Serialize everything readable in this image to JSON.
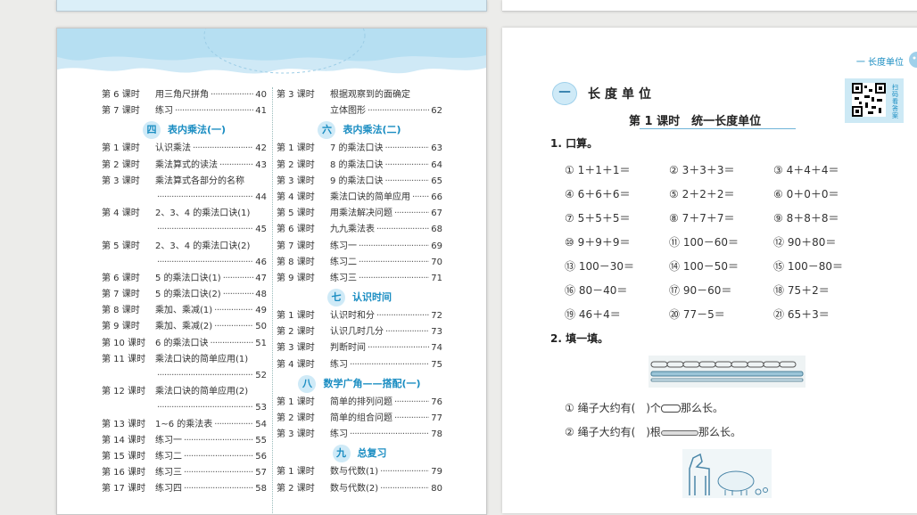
{
  "toc": {
    "left": [
      {
        "type": "row",
        "lesson": "第 6 课时",
        "title": "用三角尺拼角",
        "page": "40"
      },
      {
        "type": "row",
        "lesson": "第 7 课时",
        "title": "练习",
        "page": "41"
      },
      {
        "type": "unit",
        "num": "四",
        "title": "表内乘法(一)"
      },
      {
        "type": "row",
        "lesson": "第 1 课时",
        "title": "认识乘法",
        "page": "42"
      },
      {
        "type": "row",
        "lesson": "第 2 课时",
        "title": "乘法算式的读法",
        "page": "43"
      },
      {
        "type": "row",
        "lesson": "第 3 课时",
        "title": "乘法算式各部分的名称",
        "page": ""
      },
      {
        "type": "cont",
        "page": "44"
      },
      {
        "type": "row",
        "lesson": "第 4 课时",
        "title": "2、3、4 的乘法口诀(1)",
        "page": ""
      },
      {
        "type": "cont",
        "page": "45"
      },
      {
        "type": "row",
        "lesson": "第 5 课时",
        "title": "2、3、4 的乘法口诀(2)",
        "page": ""
      },
      {
        "type": "cont",
        "page": "46"
      },
      {
        "type": "row",
        "lesson": "第 6 课时",
        "title": "5 的乘法口诀(1)",
        "page": "47"
      },
      {
        "type": "row",
        "lesson": "第 7 课时",
        "title": "5 的乘法口诀(2)",
        "page": "48"
      },
      {
        "type": "row",
        "lesson": "第 8 课时",
        "title": "乘加、乘减(1)",
        "page": "49"
      },
      {
        "type": "row",
        "lesson": "第 9 课时",
        "title": "乘加、乘减(2)",
        "page": "50"
      },
      {
        "type": "row",
        "lesson": "第 10 课时",
        "title": "6 的乘法口诀",
        "page": "51"
      },
      {
        "type": "row",
        "lesson": "第 11 课时",
        "title": "乘法口诀的简单应用(1)",
        "page": ""
      },
      {
        "type": "cont",
        "page": "52"
      },
      {
        "type": "row",
        "lesson": "第 12 课时",
        "title": "乘法口诀的简单应用(2)",
        "page": ""
      },
      {
        "type": "cont",
        "page": "53"
      },
      {
        "type": "row",
        "lesson": "第 13 课时",
        "title": "1~6 的乘法表",
        "page": "54"
      },
      {
        "type": "row",
        "lesson": "第 14 课时",
        "title": "练习一",
        "page": "55"
      },
      {
        "type": "row",
        "lesson": "第 15 课时",
        "title": "练习二",
        "page": "56"
      },
      {
        "type": "row",
        "lesson": "第 16 课时",
        "title": "练习三",
        "page": "57"
      },
      {
        "type": "row",
        "lesson": "第 17 课时",
        "title": "练习四",
        "page": "58"
      }
    ],
    "right": [
      {
        "type": "row",
        "lesson": "第 3 课时",
        "title": "根据观察到的面确定",
        "page": ""
      },
      {
        "type": "cont",
        "text": "立体图形",
        "page": "62"
      },
      {
        "type": "unit",
        "num": "六",
        "title": "表内乘法(二)"
      },
      {
        "type": "row",
        "lesson": "第 1 课时",
        "title": "7 的乘法口诀",
        "page": "63"
      },
      {
        "type": "row",
        "lesson": "第 2 课时",
        "title": "8 的乘法口诀",
        "page": "64"
      },
      {
        "type": "row",
        "lesson": "第 3 课时",
        "title": "9 的乘法口诀",
        "page": "65"
      },
      {
        "type": "row",
        "lesson": "第 4 课时",
        "title": "乘法口诀的简单应用",
        "page": "66"
      },
      {
        "type": "row",
        "lesson": "第 5 课时",
        "title": "用乘法解决问题",
        "page": "67"
      },
      {
        "type": "row",
        "lesson": "第 6 课时",
        "title": "九九乘法表",
        "page": "68"
      },
      {
        "type": "row",
        "lesson": "第 7 课时",
        "title": "练习一",
        "page": "69"
      },
      {
        "type": "row",
        "lesson": "第 8 课时",
        "title": "练习二",
        "page": "70"
      },
      {
        "type": "row",
        "lesson": "第 9 课时",
        "title": "练习三",
        "page": "71"
      },
      {
        "type": "unit",
        "num": "七",
        "title": "认识时间"
      },
      {
        "type": "row",
        "lesson": "第 1 课时",
        "title": "认识时和分",
        "page": "72"
      },
      {
        "type": "row",
        "lesson": "第 2 课时",
        "title": "认识几时几分",
        "page": "73"
      },
      {
        "type": "row",
        "lesson": "第 3 课时",
        "title": "判断时间",
        "page": "74"
      },
      {
        "type": "row",
        "lesson": "第 4 课时",
        "title": "练习",
        "page": "75"
      },
      {
        "type": "unit",
        "num": "八",
        "title": "数学广角——搭配(一)"
      },
      {
        "type": "row",
        "lesson": "第 1 课时",
        "title": "简单的排列问题",
        "page": "76"
      },
      {
        "type": "row",
        "lesson": "第 2 课时",
        "title": "简单的组合问题",
        "page": "77"
      },
      {
        "type": "row",
        "lesson": "第 3 课时",
        "title": "练习",
        "page": "78"
      },
      {
        "type": "unit",
        "num": "九",
        "title": "总复习"
      },
      {
        "type": "row",
        "lesson": "第 1 课时",
        "title": "数与代数(1)",
        "page": "79"
      },
      {
        "type": "row",
        "lesson": "第 2 课时",
        "title": "数与代数(2)",
        "page": "80"
      }
    ]
  },
  "right_page": {
    "header": "一 长度单位",
    "qr_label": "扫码看答案",
    "chapter_num": "一",
    "chapter_title": "长度单位",
    "lesson_title": "第 1 课时　统一长度单位",
    "q1_title": "1. 口算。",
    "q1_items": [
      [
        "① 1＋1＋1＝",
        "② 3＋3＋3＝",
        "③ 4＋4＋4＝"
      ],
      [
        "④ 6＋6＋6＝",
        "⑤ 2＋2＋2＝",
        "⑥ 0＋0＋0＝"
      ],
      [
        "⑦ 5＋5＋5＝",
        "⑧ 7＋7＋7＝",
        "⑨ 8＋8＋8＝"
      ],
      [
        "⑩ 9＋9＋9＝",
        "⑪ 100－60＝",
        "⑫ 90＋80＝"
      ],
      [
        "⑬ 100－30＝",
        "⑭ 100－50＝",
        "⑮ 100－80＝"
      ],
      [
        "⑯ 80－40＝",
        "⑰ 90－60＝",
        "⑱ 75＋2＝"
      ],
      [
        "⑲ 46＋4＝",
        "⑳ 77－5＝",
        "㉑ 65＋3＝"
      ]
    ],
    "q2_title": "2. 填一填。",
    "fill1_a": "① 绳子大约有(　)个",
    "fill1_b": "那么长。",
    "fill2_a": "② 绳子大约有(　)根",
    "fill2_b": "那么长。"
  }
}
